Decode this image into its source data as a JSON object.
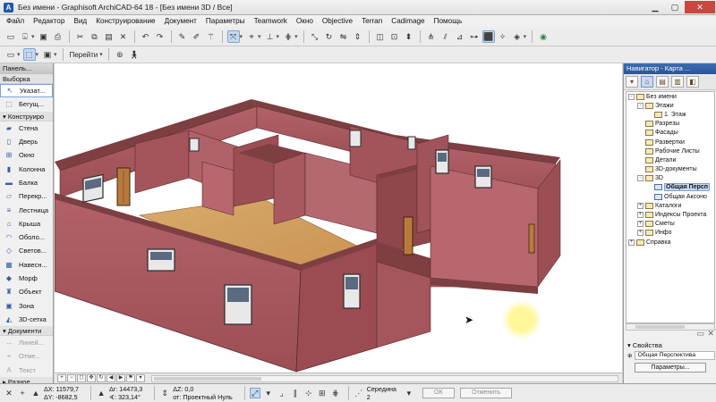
{
  "window": {
    "title": "Без имени - Graphisoft ArchiCAD-64 18 - [Без имени 3D / Все]",
    "app_icon": "A",
    "controls": [
      "minimize",
      "maximize",
      "close"
    ]
  },
  "menubar": [
    "Файл",
    "Редактор",
    "Вид",
    "Конструирование",
    "Документ",
    "Параметры",
    "Teamwork",
    "Окно",
    "Objective",
    "Terran",
    "Cadimage",
    "Помощь"
  ],
  "toolbar2": {
    "goto_label": "Перейти"
  },
  "toolbox": {
    "title": "Панель...",
    "select_section": "Выборка",
    "select_items": [
      {
        "label": "Указат...",
        "icon": "arrow-icon",
        "glyph": "↖"
      },
      {
        "label": "Бегущ...",
        "icon": "marquee-icon",
        "glyph": "⬚"
      }
    ],
    "design_section": "Конструиро",
    "design_items": [
      {
        "label": "Стена",
        "icon": "wall-icon",
        "glyph": "▰"
      },
      {
        "label": "Дверь",
        "icon": "door-icon",
        "glyph": "▯"
      },
      {
        "label": "Окно",
        "icon": "window-icon",
        "glyph": "⊞"
      },
      {
        "label": "Колонна",
        "icon": "column-icon",
        "glyph": "▮"
      },
      {
        "label": "Балка",
        "icon": "beam-icon",
        "glyph": "▬"
      },
      {
        "label": "Перекр...",
        "icon": "slab-icon",
        "glyph": "▱"
      },
      {
        "label": "Лестница",
        "icon": "stair-icon",
        "glyph": "≡"
      },
      {
        "label": "Крыша",
        "icon": "roof-icon",
        "glyph": "⌂"
      },
      {
        "label": "Оболо...",
        "icon": "shell-icon",
        "glyph": "◠"
      },
      {
        "label": "Светов...",
        "icon": "skylight-icon",
        "glyph": "◇"
      },
      {
        "label": "Навесн...",
        "icon": "curtain-wall-icon",
        "glyph": "▦"
      },
      {
        "label": "Морф",
        "icon": "morph-icon",
        "glyph": "◆"
      },
      {
        "label": "Объект",
        "icon": "object-icon",
        "glyph": "♜"
      },
      {
        "label": "Зона",
        "icon": "zone-icon",
        "glyph": "▣"
      },
      {
        "label": "3D-сетка",
        "icon": "mesh-icon",
        "glyph": "◭"
      }
    ],
    "document_section": "Документи",
    "document_items": [
      {
        "label": "Линей...",
        "icon": "dimension-icon",
        "glyph": "↔"
      },
      {
        "label": "Отме...",
        "icon": "level-icon",
        "glyph": "⌖"
      },
      {
        "label": "Текст",
        "icon": "text-icon",
        "glyph": "A"
      }
    ],
    "more_section": "Разное"
  },
  "navigator": {
    "title": "Навигатор - Карта ...",
    "tree": [
      {
        "label": "Без имени",
        "level": 0,
        "exp": "-",
        "icon": "home"
      },
      {
        "label": "Этажи",
        "level": 1,
        "exp": "-",
        "icon": "folder"
      },
      {
        "label": "1. Этаж",
        "level": 2,
        "exp": "",
        "icon": "folder"
      },
      {
        "label": "Разрезы",
        "level": 1,
        "exp": "",
        "icon": "folder"
      },
      {
        "label": "Фасады",
        "level": 1,
        "exp": "",
        "icon": "folder"
      },
      {
        "label": "Развертки",
        "level": 1,
        "exp": "",
        "icon": "folder"
      },
      {
        "label": "Рабочие Листы",
        "level": 1,
        "exp": "",
        "icon": "folder"
      },
      {
        "label": "Детали",
        "level": 1,
        "exp": "",
        "icon": "folder"
      },
      {
        "label": "3D-документы",
        "level": 1,
        "exp": "",
        "icon": "folder"
      },
      {
        "label": "3D",
        "level": 1,
        "exp": "-",
        "icon": "folder"
      },
      {
        "label": "Общая Персп",
        "level": 2,
        "exp": "",
        "icon": "cube",
        "selected": true
      },
      {
        "label": "Общая Аксоно",
        "level": 2,
        "exp": "",
        "icon": "cube"
      },
      {
        "label": "Каталоги",
        "level": 1,
        "exp": "+",
        "icon": "folder"
      },
      {
        "label": "Индексы Проекта",
        "level": 1,
        "exp": "+",
        "icon": "folder"
      },
      {
        "label": "Сметы",
        "level": 1,
        "exp": "+",
        "icon": "folder"
      },
      {
        "label": "Инфо",
        "level": 1,
        "exp": "+",
        "icon": "folder"
      },
      {
        "label": "Справка",
        "level": 0,
        "exp": "+",
        "icon": "folder"
      }
    ],
    "properties": {
      "header": "Свойства",
      "field_value": "Общая Перспектива",
      "params_button": "Параметры..."
    }
  },
  "statusbar": {
    "dx": "ΔX: 11579,7",
    "dy": "ΔY: -8682,5",
    "dr": "Δr: 14473,3",
    "angle": "∢: 323,14°",
    "dz": "ΔZ: 0,0",
    "ref": "от: Проектный Нуль",
    "snap_label": "Середина",
    "snap_value": "2",
    "ok": "OK",
    "cancel": "Отменить"
  },
  "colors": {
    "wall_side": "#a8585c",
    "wall_top": "#7d3f42",
    "floor": "#d1a265",
    "sky": "#ffffff",
    "accent": "#2b5597"
  }
}
